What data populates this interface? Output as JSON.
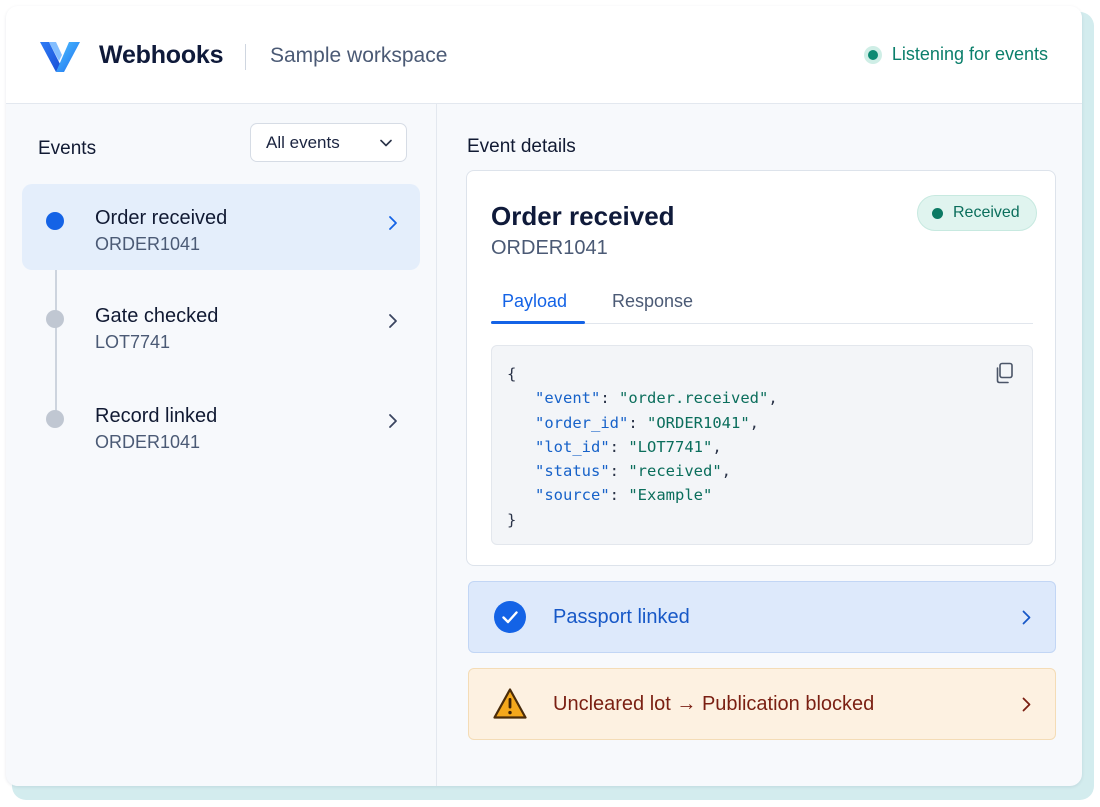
{
  "header": {
    "app_title": "Webhooks",
    "workspace": "Sample workspace",
    "status": "Listening for events"
  },
  "sidebar": {
    "title": "Events",
    "filter_value": "All events",
    "events": [
      {
        "name": "Order received",
        "id": "ORDER1041",
        "active": true
      },
      {
        "name": "Gate checked",
        "id": "LOT7741",
        "active": false
      },
      {
        "name": "Record linked",
        "id": "ORDER1041",
        "active": false
      }
    ]
  },
  "details": {
    "title": "Event details",
    "event_name": "Order received",
    "event_id": "ORDER1041",
    "badge": "Received",
    "tabs": [
      {
        "label": "Payload",
        "active": true
      },
      {
        "label": "Response",
        "active": false
      }
    ],
    "payload": {
      "open": "{",
      "close": "}",
      "fields": [
        {
          "key": "\"event\"",
          "value": "\"order.received\"",
          "sep": ","
        },
        {
          "key": "\"order_id\"",
          "value": "\"ORDER1041\"",
          "sep": ","
        },
        {
          "key": "\"lot_id\"",
          "value": "\"LOT7741\"",
          "sep": ","
        },
        {
          "key": "\"status\"",
          "value": "\"received\"",
          "sep": ","
        },
        {
          "key": "\"source\"",
          "value": "\"Example\"",
          "sep": ""
        }
      ]
    }
  },
  "alerts": [
    {
      "text": "Passport linked",
      "type": "success",
      "icon": "check-circle-icon"
    },
    {
      "text": "Uncleared lot → Publication blocked",
      "type": "warning",
      "icon": "warning-triangle-icon"
    }
  ],
  "colors": {
    "accent": "#1463e6",
    "success": "#0c8a72",
    "warning": "#f0a500"
  }
}
